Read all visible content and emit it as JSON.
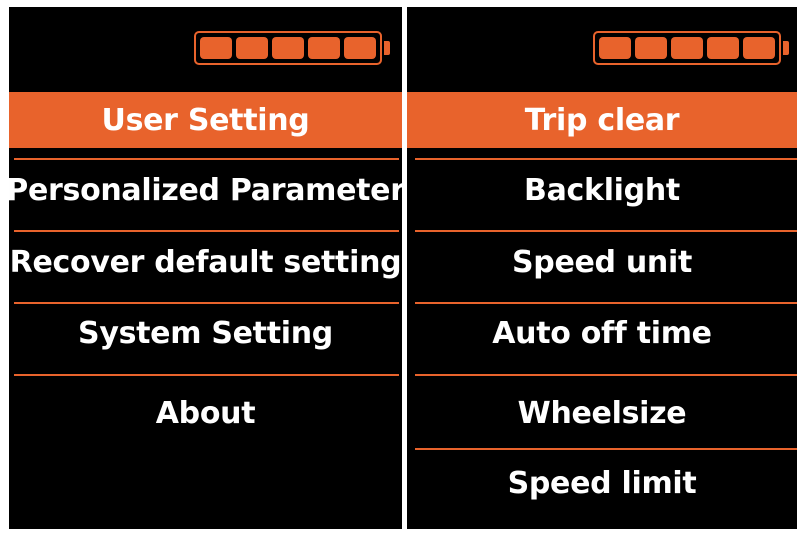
{
  "colors": {
    "accent": "#e8632c",
    "background": "#000000",
    "text": "#ffffff"
  },
  "battery": {
    "level_fraction": 1.0,
    "cells_filled": 5,
    "cells_total": 5
  },
  "left_screen": {
    "menu_items": [
      {
        "label": "User Setting",
        "selected": true
      },
      {
        "label": "Personalized Parameter",
        "selected": false
      },
      {
        "label": "Recover default setting",
        "selected": false
      },
      {
        "label": "System Setting",
        "selected": false
      },
      {
        "label": "About",
        "selected": false
      }
    ]
  },
  "right_screen": {
    "menu_items": [
      {
        "label": "Trip clear",
        "selected": true
      },
      {
        "label": "Backlight",
        "selected": false
      },
      {
        "label": "Speed unit",
        "selected": false
      },
      {
        "label": "Auto off time",
        "selected": false
      },
      {
        "label": "Wheelsize",
        "selected": false
      },
      {
        "label": "Speed limit",
        "selected": false
      }
    ]
  }
}
